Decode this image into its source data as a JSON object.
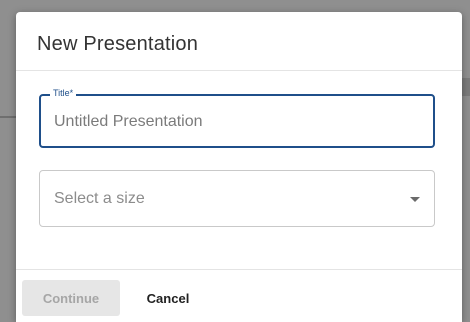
{
  "dialog": {
    "title": "New Presentation",
    "title_field": {
      "label": "Title*",
      "value": "Untitled Presentation"
    },
    "size_select": {
      "placeholder": "Select a size"
    },
    "buttons": {
      "continue_label": "Continue",
      "cancel_label": "Cancel"
    }
  },
  "colors": {
    "accent": "#1f4f8a",
    "disabled_button_bg": "#e6e6e6",
    "disabled_button_text": "#a6a6a6"
  },
  "icons": {
    "size_select_caret": "chevron-down-icon"
  }
}
